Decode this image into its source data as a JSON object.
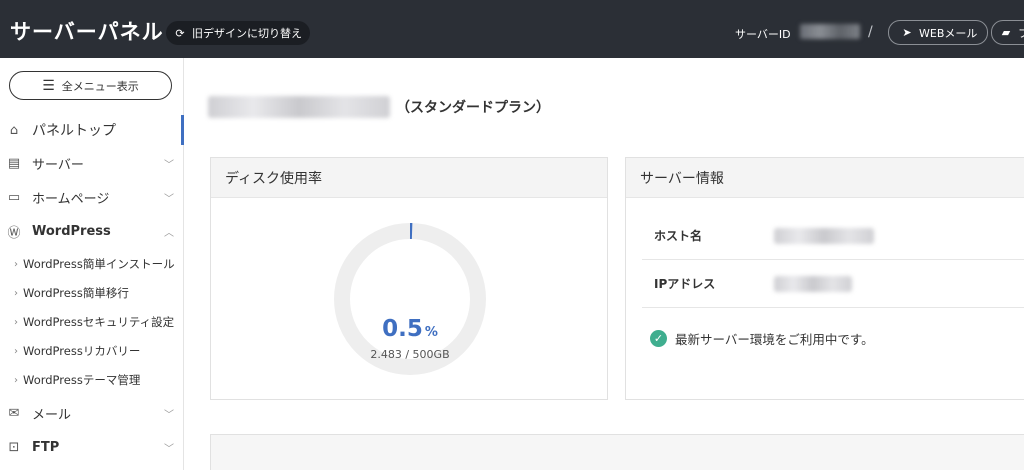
{
  "header": {
    "app_title": "サーバーパネル",
    "switch_design_label": "旧デザインに切り替え",
    "server_id_label": "サーバーID",
    "separator": "/",
    "webmail_label": "WEBメール",
    "file_label": "フ"
  },
  "sidebar": {
    "all_menu_label": "全メニュー表示",
    "items": [
      {
        "label": "パネルトップ",
        "icon": "home-icon",
        "active": true
      },
      {
        "label": "サーバー",
        "icon": "server-icon"
      },
      {
        "label": "ホームページ",
        "icon": "window-icon"
      },
      {
        "label": "WordPress",
        "icon": "wordpress-icon",
        "expanded": true
      }
    ],
    "wordpress_sub": [
      "WordPress簡単インストール",
      "WordPress簡単移行",
      "WordPressセキュリティ設定",
      "WordPressリカバリー",
      "WordPressテーマ管理"
    ],
    "items_after": [
      {
        "label": "メール",
        "icon": "mail-icon"
      },
      {
        "label": "FTP",
        "icon": "ftp-icon"
      }
    ]
  },
  "main": {
    "plan_suffix": "（スタンダードプラン）",
    "disk": {
      "title": "ディスク使用率",
      "percent_value": 0.5,
      "percent_text": "0.5",
      "percent_unit": "%",
      "usage_text": "2.483 / 500GB"
    },
    "server_info": {
      "title": "サーバー情報",
      "rows": [
        {
          "key": "ホスト名"
        },
        {
          "key": "IPアドレス"
        }
      ],
      "status": "最新サーバー環境をご利用中です。"
    }
  },
  "colors": {
    "header_bg": "#2b2f36",
    "accent": "#3f6fc1",
    "gauge_track": "#eeeeee",
    "status_green": "#3fae8f"
  }
}
